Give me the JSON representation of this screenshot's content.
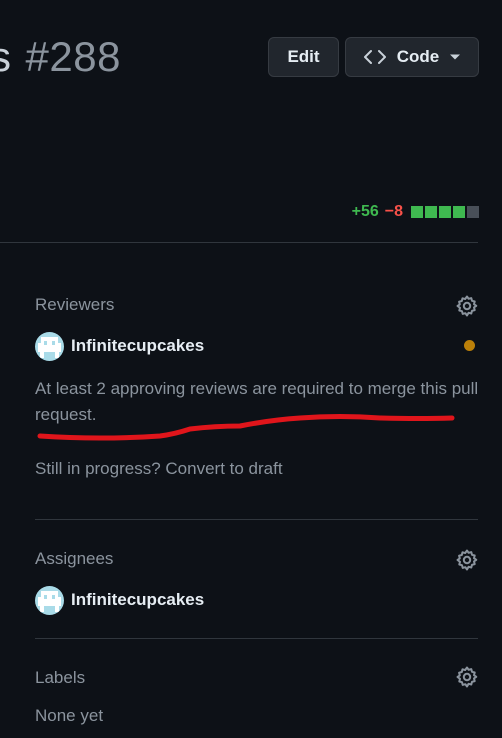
{
  "header": {
    "title_fragment": "s",
    "pr_number": "#288",
    "edit_label": "Edit",
    "code_label": "Code"
  },
  "diffstat": {
    "additions": "+56",
    "deletions": "−8",
    "colors": {
      "added": "#3fb950",
      "neutral": "#484f58"
    }
  },
  "reviewers": {
    "heading": "Reviewers",
    "user": "Infinitecupcakes",
    "status_color": "#bb8009",
    "requirement": "At least 2 approving reviews are required to merge this pull request.",
    "draft_text": "Still in progress? Convert to draft"
  },
  "assignees": {
    "heading": "Assignees",
    "user": "Infinitecupcakes"
  },
  "labels": {
    "heading": "Labels",
    "value": "None yet"
  },
  "annotation": {
    "color": "#e0151b"
  }
}
